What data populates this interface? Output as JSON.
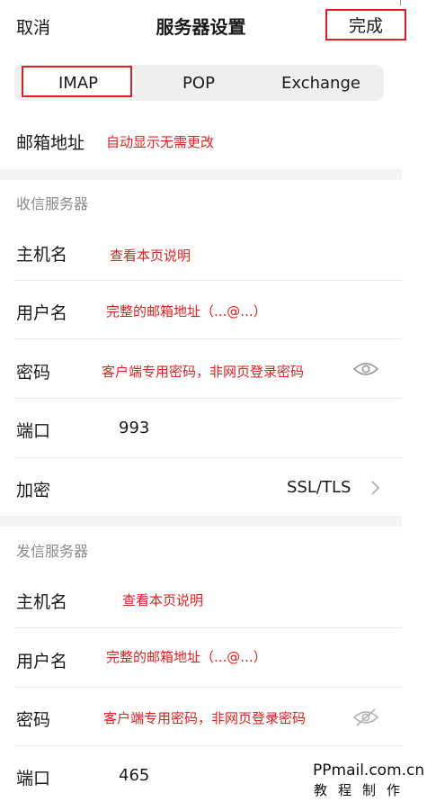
{
  "header": {
    "cancel_label": "取消",
    "title": "服务器设置",
    "done_label": "完成"
  },
  "tabs": [
    {
      "label": "IMAP",
      "selected": true
    },
    {
      "label": "POP",
      "selected": false
    },
    {
      "label": "Exchange",
      "selected": false
    }
  ],
  "mailbox": {
    "label": "邮箱地址",
    "note": "自动显示无需更改"
  },
  "incoming": {
    "section_title": "收信服务器",
    "host_label": "主机名",
    "host_note": "查看本页说明",
    "user_label": "用户名",
    "user_note": "完整的邮箱地址（...@...）",
    "password_label": "密码",
    "password_note": "客户端专用密码，非网页登录密码",
    "password_icon": "eye-icon",
    "port_label": "端口",
    "port_value": "993",
    "encryption_label": "加密",
    "encryption_value": "SSL/TLS"
  },
  "outgoing": {
    "section_title": "发信服务器",
    "host_label": "主机名",
    "host_note": "查看本页说明",
    "user_label": "用户名",
    "user_note": "完整的邮箱地址（...@...）",
    "password_label": "密码",
    "password_note": "客户端专用密码，非网页登录密码",
    "password_icon": "eye-off-icon",
    "port_label": "端口",
    "port_value": "465"
  },
  "watermark": {
    "line1": "PPmail.com.cn",
    "line2": "教程制作"
  },
  "colors": {
    "annotation_red": "#e02020",
    "segment_bg": "#efefef",
    "section_band": "#f4f4f4"
  }
}
